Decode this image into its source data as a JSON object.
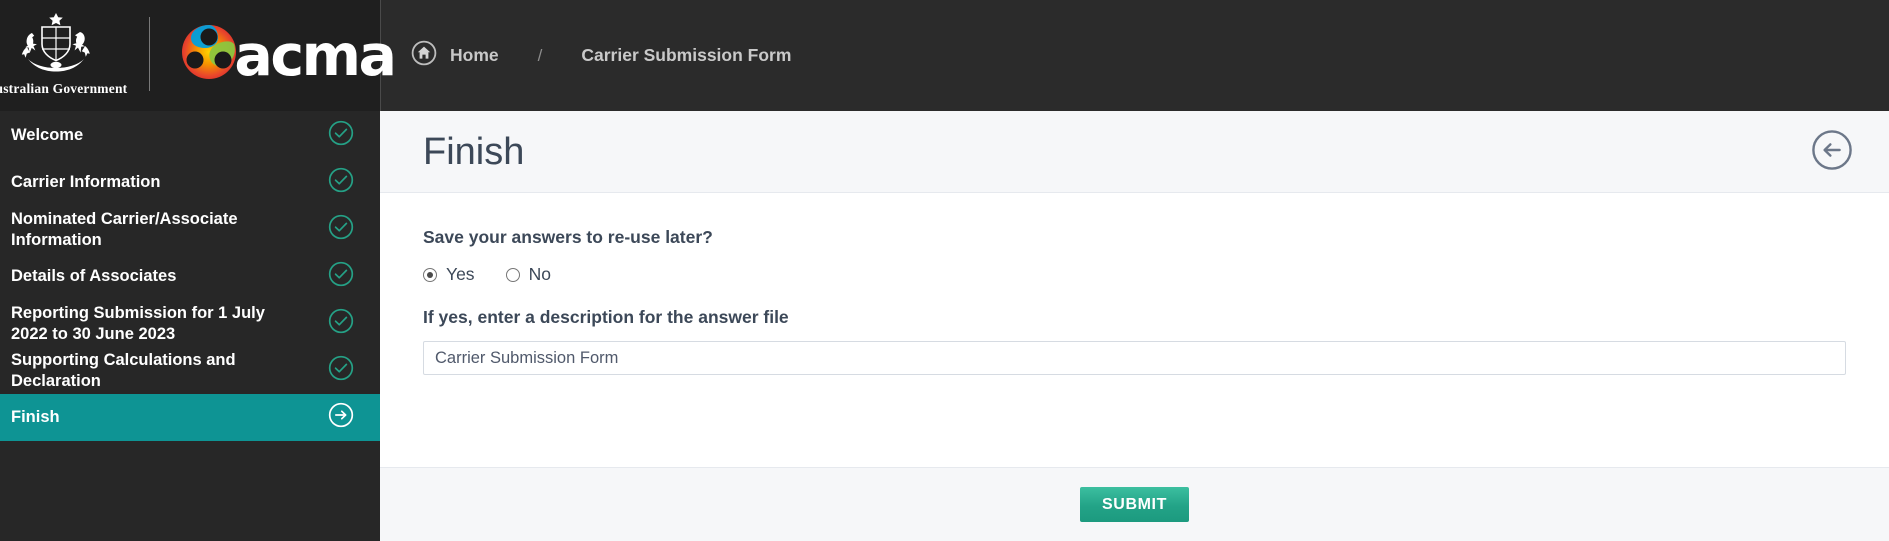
{
  "brand": {
    "government_text": "Australian Government",
    "acma_wordmark": "acma"
  },
  "breadcrumb": {
    "home_label": "Home",
    "separator": "/",
    "current_label": "Carrier Submission Form"
  },
  "sidebar": {
    "items": [
      {
        "label": "Welcome",
        "state": "complete",
        "icon": "check-circle-icon"
      },
      {
        "label": "Carrier Information",
        "state": "complete",
        "icon": "check-circle-icon"
      },
      {
        "label": "Nominated Carrier/Associate Information",
        "state": "complete",
        "icon": "check-circle-icon"
      },
      {
        "label": "Details of Associates",
        "state": "complete",
        "icon": "check-circle-icon"
      },
      {
        "label": "Reporting Submission for 1 July 2022 to 30 June 2023",
        "state": "complete",
        "icon": "check-circle-icon"
      },
      {
        "label": "Supporting Calculations and Declaration",
        "state": "complete",
        "icon": "check-circle-icon"
      },
      {
        "label": "Finish",
        "state": "active",
        "icon": "arrow-right-circle-icon"
      }
    ]
  },
  "page": {
    "title": "Finish",
    "back_icon": "arrow-left-circle-icon"
  },
  "form": {
    "question_label": "Save your answers to re-use later?",
    "options": [
      {
        "label": "Yes",
        "selected": true
      },
      {
        "label": "No",
        "selected": false
      }
    ],
    "description_label": "If yes, enter a description for the answer file",
    "description_value": "Carrier Submission Form",
    "description_placeholder": ""
  },
  "footer": {
    "submit_label": "SUBMIT"
  },
  "colors": {
    "sidebar_bg": "#272727",
    "active_teal": "#0e9494",
    "check_green": "#25a186",
    "submit_green": "#23a387",
    "page_head_bg": "#f6f7f9",
    "text_dark": "#3c4858"
  }
}
